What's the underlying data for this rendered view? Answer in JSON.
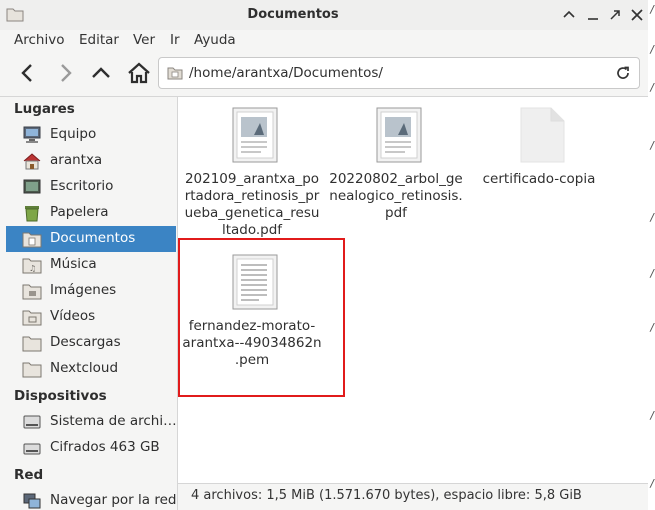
{
  "window": {
    "title": "Documentos"
  },
  "menu": [
    "Archivo",
    "Editar",
    "Ver",
    "Ir",
    "Ayuda"
  ],
  "location": {
    "path": "/home/arantxa/Documentos/"
  },
  "sidebar": {
    "places_header": "Lugares",
    "places": [
      {
        "label": "Equipo",
        "icon": "computer-icon"
      },
      {
        "label": "arantxa",
        "icon": "home-icon"
      },
      {
        "label": "Escritorio",
        "icon": "desktop-icon"
      },
      {
        "label": "Papelera",
        "icon": "trash-icon"
      },
      {
        "label": "Documentos",
        "icon": "documents-folder-icon",
        "active": true
      },
      {
        "label": "Música",
        "icon": "music-folder-icon"
      },
      {
        "label": "Imágenes",
        "icon": "pictures-folder-icon"
      },
      {
        "label": "Vídeos",
        "icon": "videos-folder-icon"
      },
      {
        "label": "Descargas",
        "icon": "downloads-folder-icon"
      },
      {
        "label": "Nextcloud",
        "icon": "folder-icon"
      }
    ],
    "devices_header": "Dispositivos",
    "devices": [
      {
        "label": "Sistema de archi…",
        "icon": "drive-icon"
      },
      {
        "label": "Cifrados 463 GB",
        "icon": "drive-icon"
      }
    ],
    "network_header": "Red",
    "network": [
      {
        "label": "Navegar por la red",
        "icon": "network-icon"
      }
    ]
  },
  "files": [
    {
      "name_lines": [
        "202109_arantxa_po",
        "rtadora_retinosis_pr",
        "ueba_genetica_resu",
        "ltado.pdf"
      ],
      "icon": "pdf-document-icon"
    },
    {
      "name_lines": [
        "20220802_arbol_ge",
        "nealogico_retinosis.",
        "pdf"
      ],
      "icon": "pdf-document-icon"
    },
    {
      "name_lines": [
        "certificado-copia"
      ],
      "icon": "blank-file-icon"
    },
    {
      "name_lines": [
        "fernandez-morato-",
        "arantxa--49034862n",
        ".pem"
      ],
      "icon": "text-document-icon"
    }
  ],
  "status": {
    "text": "4 archivos: 1,5 MiB (1.571.670 bytes), espacio libre: 5,8 GiB"
  },
  "colors": {
    "selection": "#3b84c4",
    "highlight_box": "#e11b1b"
  }
}
